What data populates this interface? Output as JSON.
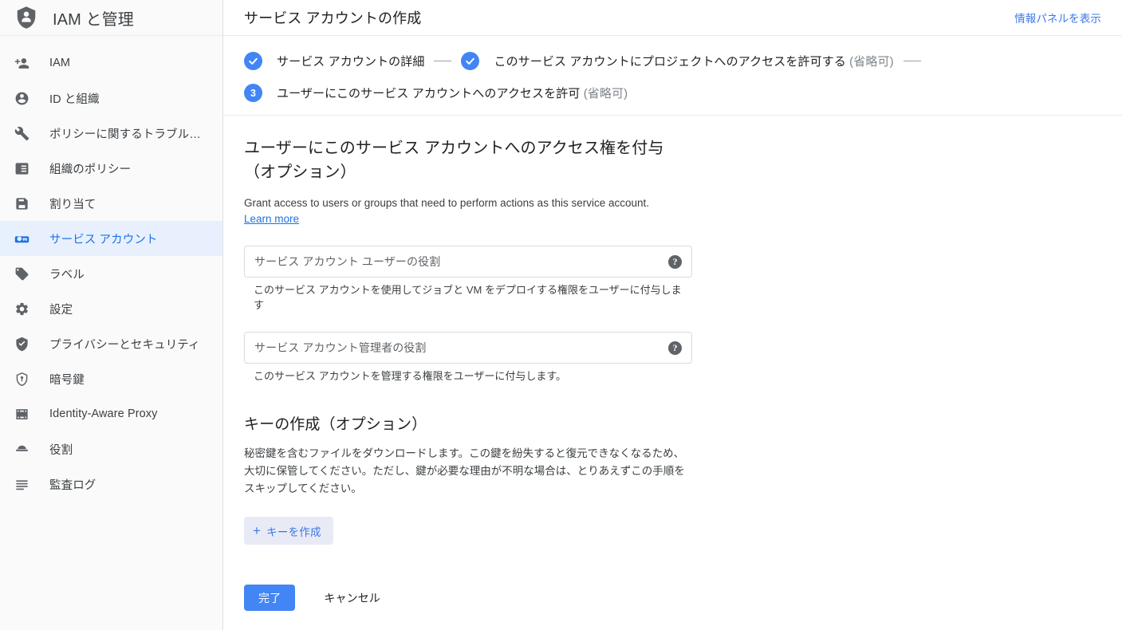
{
  "sidebar": {
    "logo_icon": "shield-person-icon",
    "title": "IAM と管理",
    "items": [
      {
        "label": "IAM",
        "icon": "person-add-icon",
        "active": false
      },
      {
        "label": "ID と組織",
        "icon": "account-circle-icon",
        "active": false
      },
      {
        "label": "ポリシーに関するトラブル…",
        "icon": "wrench-icon",
        "active": false
      },
      {
        "label": "組織のポリシー",
        "icon": "policy-card-icon",
        "active": false
      },
      {
        "label": "割り当て",
        "icon": "quota-save-icon",
        "active": false
      },
      {
        "label": "サービス アカウント",
        "icon": "service-account-badge-icon",
        "active": true
      },
      {
        "label": "ラベル",
        "icon": "label-tag-icon",
        "active": false
      },
      {
        "label": "設定",
        "icon": "gear-icon",
        "active": false
      },
      {
        "label": "プライバシーとセキュリティ",
        "icon": "shield-check-icon",
        "active": false
      },
      {
        "label": "暗号鍵",
        "icon": "key-shield-icon",
        "active": false
      },
      {
        "label": "Identity-Aware Proxy",
        "icon": "iap-frame-icon",
        "active": false
      },
      {
        "label": "役割",
        "icon": "roles-hat-icon",
        "active": false
      },
      {
        "label": "監査ログ",
        "icon": "audit-log-lines-icon",
        "active": false
      }
    ]
  },
  "header": {
    "title": "サービス アカウントの作成",
    "info_panel_link": "情報パネルを表示"
  },
  "stepper": {
    "steps": [
      {
        "badge": "check",
        "label": "サービス アカウントの詳細",
        "optional": ""
      },
      {
        "badge": "check",
        "label": "このサービス アカウントにプロジェクトへのアクセスを許可する",
        "optional": "(省略可)"
      },
      {
        "badge": "3",
        "label": "ユーザーにこのサービス アカウントへのアクセスを許可",
        "optional": "(省略可)"
      }
    ]
  },
  "access_section": {
    "heading": "ユーザーにこのサービス アカウントへのアクセス権を付与（オプション）",
    "description": "Grant access to users or groups that need to perform actions as this service account.",
    "learn_more": "Learn more",
    "fields": [
      {
        "placeholder": "サービス アカウント ユーザーの役割",
        "hint": "このサービス アカウントを使用してジョブと VM をデプロイする権限をユーザーに付与します",
        "help_icon": "help-icon"
      },
      {
        "placeholder": "サービス アカウント管理者の役割",
        "hint": "このサービス アカウントを管理する権限をユーザーに付与します。",
        "help_icon": "help-icon"
      }
    ]
  },
  "key_section": {
    "heading": "キーの作成（オプション）",
    "description": "秘密鍵を含むファイルをダウンロードします。この鍵を紛失すると復元できなくなるため、大切に保管してください。ただし、鍵が必要な理由が不明な場合は、とりあえずこの手順をスキップしてください。",
    "create_key_button": "キーを作成",
    "create_key_icon": "plus-icon"
  },
  "actions": {
    "done": "完了",
    "cancel": "キャンセル"
  },
  "colors": {
    "accent_blue": "#4285f4",
    "link_blue": "#1a73e8",
    "active_bg": "#e8f0fe",
    "sidebar_bg": "#fafafa",
    "text_primary": "#202124",
    "text_secondary": "#5f6368"
  }
}
